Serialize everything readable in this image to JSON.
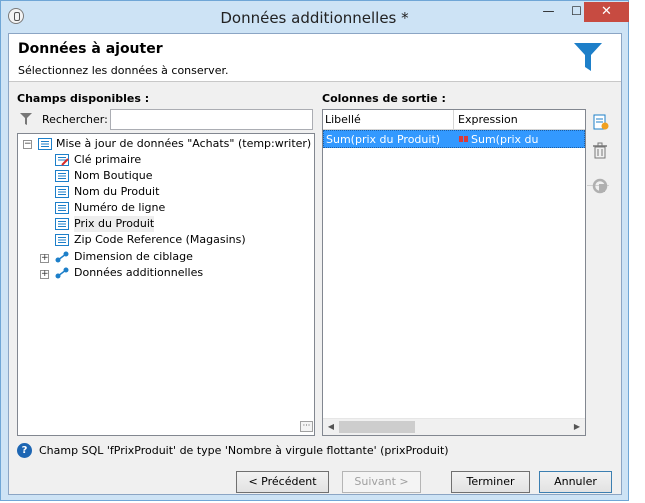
{
  "window": {
    "title": "Données additionnelles *",
    "minimize": "—",
    "maximize": "☐",
    "close": "✕"
  },
  "header": {
    "title": "Données à ajouter",
    "subtitle": "Sélectionnez les données à conserver."
  },
  "left_panel": {
    "label": "Champs disponibles :",
    "search_label": "Rechercher:",
    "search_value": "",
    "tree": {
      "root": "Mise à jour de données \"Achats\" (temp:writer)",
      "root_expander": "−",
      "fields": [
        "Clé primaire",
        "Nom Boutique",
        "Nom du Produit",
        "Numéro de ligne",
        "Prix du Produit",
        "Zip Code Reference (Magasins)"
      ],
      "links": [
        "Dimension de ciblage",
        "Données additionnelles"
      ],
      "link_expander": "+"
    },
    "more_button": "···"
  },
  "right_panel": {
    "label": "Colonnes de sortie :",
    "columns": [
      "Libellé",
      "Expression"
    ],
    "rows": [
      {
        "libelle": "Sum(prix du Produit)",
        "expression": "Sum(prix du Produit)"
      }
    ],
    "scroll_left": "◀",
    "scroll_right": "▶"
  },
  "side_toolbar": {
    "add": "add-column-icon",
    "delete": "trash-icon",
    "edit": "edit-expression-icon"
  },
  "status": {
    "help": "?",
    "text": "Champ SQL 'fPrixProduit' de type 'Nombre à virgule flottante' (prixProduit)"
  },
  "footer": {
    "previous": "< Précédent",
    "next": "Suivant >",
    "finish": "Terminer",
    "cancel": "Annuler"
  },
  "colors": {
    "titlebar": "#cde3f5",
    "selection": "#3399ff",
    "close_button": "#c74b41",
    "accent": "#1d7fc9"
  }
}
